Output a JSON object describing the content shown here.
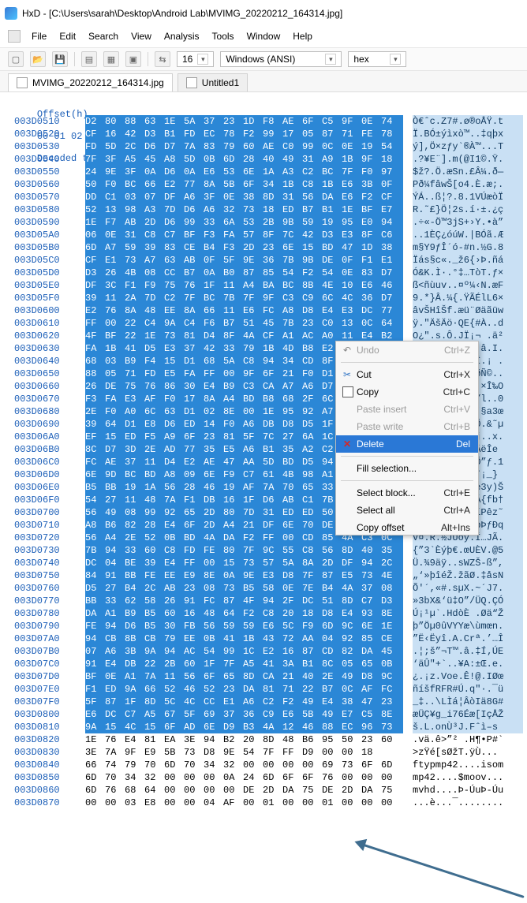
{
  "title_bar": {
    "title": "HxD - [C:\\Users\\sarah\\Desktop\\Android Lab\\MVIMG_20220212_164314.jpg]"
  },
  "menu": [
    "File",
    "Edit",
    "Search",
    "View",
    "Analysis",
    "Tools",
    "Window",
    "Help"
  ],
  "toolbar": {
    "bytes_per_row": "16",
    "encoding": "Windows (ANSI)",
    "number_format": "hex"
  },
  "tabs": [
    "MVIMG_20220212_164314.jpg",
    "Untitled1"
  ],
  "hex_header": {
    "offset": "Offset(h)",
    "columns": "00 01 02 03 04 05 06 07 08 09 0A 0B 0C 0D 0E 0F",
    "decoded": "Decoded text"
  },
  "rows": [
    {
      "offset": "003D0510",
      "bytes": "D2 80 88 63 1E 5A 37 23 1D F8 AE 6F C5 9F 0E 74",
      "text": "Ò€ˆc.Z7#.ø®oÅŸ.t"
    },
    {
      "offset": "003D0520",
      "bytes": "CF 16 42 D3 B1 FD EC 78 F2 99 17 05 87 71 FE 78",
      "text": "Ï.BÓ±ýìxò™..‡qþx"
    },
    {
      "offset": "003D0530",
      "bytes": "FD 5D 2C D6 D7 7A 83 79 60 AE C0 99 0C 0E 19 54",
      "text": "ý],Ö×zƒy`®À™...T"
    },
    {
      "offset": "003D0540",
      "bytes": "7F 3F A5 45 A8 5D 0B 6D 28 40 49 31 A9 1B 9F 18",
      "text": ".?¥E¨].m(@I1©.Ÿ."
    },
    {
      "offset": "003D0550",
      "bytes": "24 9E 3F 0A D6 0A E6 53 6E 1A A3 C2 BC 7F F0 97",
      "text": "$ž?.Ö.æSn.£Â¼.ð—"
    },
    {
      "offset": "003D0560",
      "bytes": "50 F0 BC 66 E2 77 8A 5B 6F 34 1B C8 1B E6 3B 0F",
      "text": "Pð¼fâwŠ[o4.È.æ;."
    },
    {
      "offset": "003D0570",
      "bytes": "DD C1 03 07 DF A6 3F 0E 38 8D 31 56 DA E6 F2 CF",
      "text": "ÝÁ..ß¦?.8.1VÚæòÏ"
    },
    {
      "offset": "003D0580",
      "bytes": "52 13 98 A3 7D D6 A6 32 73 18 ED B7 B1 1E BF E7",
      "text": "R.˜£}Ö¦2s.í·±.¿ç"
    },
    {
      "offset": "003D0590",
      "bytes": "1E F7 AB 2D D6 99 33 6A 53 2B 9B 59 19 95 E0 94",
      "text": ".÷«-Ö™3jS+›Y.•à”"
    },
    {
      "offset": "003D05A0",
      "bytes": "06 0E 31 C8 C7 BF F3 FA 57 8F 7C 42 D3 E3 8F C6",
      "text": "..1ÈÇ¿óúW.|BÓã.Æ"
    },
    {
      "offset": "003D05B0",
      "bytes": "6D A7 59 39 83 CE B4 F3 2D 23 6E 15 BD 47 1D 38",
      "text": "m§Y9ƒÎ´ó-#n.½G.8"
    },
    {
      "offset": "003D05C0",
      "bytes": "CF E1 73 A7 63 AB 0F 5F 9E 36 7B 9B DE 0F F1 E1",
      "text": "Ïás§c«._ž6{›Þ.ñá"
    },
    {
      "offset": "003D05D0",
      "bytes": "D3 26 4B 08 CC B7 0A B0 87 85 54 F2 54 0E 83 D7",
      "text": "Ó&K.Ì·.°‡…TòT.ƒ×"
    },
    {
      "offset": "003D05E0",
      "bytes": "DF 3C F1 F9 75 76 1F 11 A4 BA BC 8B 4E 10 E6 46",
      "text": "ß<ñùuv..¤º¼‹N.æF"
    },
    {
      "offset": "003D05F0",
      "bytes": "39 11 2A 7D C2 7F BC 7B 7F 9F C3 C9 6C 4C 36 D7",
      "text": "9.*}Â.¼{.ŸÃÉlL6×"
    },
    {
      "offset": "003D0600",
      "bytes": "E2 76 8A 48 EE 8A 66 11 E6 FC A8 D8 E4 E3 DC 77",
      "text": "âvŠHîŠf.æü¨Øäãüw"
    },
    {
      "offset": "003D0610",
      "bytes": "FF 00 22 C4 9A C4 F6 B7 51 45 7B 23 C0 13 0C 64",
      "text": "ÿ.\"ÄšÄö·QE{#À..d"
    },
    {
      "offset": "003D0620",
      "bytes": "4F BF 22 1E 73 81 D4 8F 4A CF A1 AC A0 11 E4 B2",
      "text": "O¿\".s.Ô.JÏ¡¬ .ä²"
    },
    {
      "offset": "003D0630",
      "bytes": "FA 1B 41 D5 E3 37 42 33 79 1B 4D B8 E2 1D 49 1B",
      "text": "ú.AÕã7B3y.M¸â.I."
    },
    {
      "offset": "003D0640",
      "bytes": "68 03 B9 F4 15 D1 68 5A C8 94 34 CD 8F A1 20 0D",
      "text": "h.¹ô.ÑhZÈ”4Í.¡ ."
    },
    {
      "offset": "003D0650",
      "bytes": "88 05 71 FD E5 FA FF 00 9F 6F 21 F0 D1 A9 0C 1F",
      "text": "ˆ.qýåúÿ.Ÿo!ðÑ©.."
    },
    {
      "offset": "003D0660",
      "bytes": "26 DE 75 76 86 30 E4 B9 C3 CA A7 A6 D7 CE 89 4F",
      "text": "&Þuv†0ä¹ÃÊ§¦×Î‰O"
    },
    {
      "offset": "003D0670",
      "bytes": "F3 FA E3 AF F0 17 8A A4 BD B8 68 2F 6C 1E 1F 30",
      "text": "óúã¯ð.Š¤½¸h/l..0"
    },
    {
      "offset": "003D0680",
      "bytes": "2E F0 A0 6C 63 D1 02 8E 00 1E 95 92 A7 61 33 9C",
      "text": ".ð lcÑ.Ž..•’§a3œ"
    },
    {
      "offset": "003D0690",
      "bytes": "39 64 D1 E8 D6 ED 14 F0 A6 DB D8 D5 1F 26 98 B5",
      "text": "9dÑèÖí.ð¦ÛØÕ.&˜µ"
    },
    {
      "offset": "003D06A0",
      "bytes": "EF 15 ED F5 A9 6F 23 81 5F 7C 27 6A 1C 9D 78 2E",
      "text": "ï.íõ©o#._|'j..x."
    },
    {
      "offset": "003D06B0",
      "bytes": "8C D7 3D 2E AD 77 35 E5 A6 B1 35 A2 C2 EB CE 65",
      "text": "Œ×=.­w5å¦±5¢ÂëÎe"
    },
    {
      "offset": "003D06C0",
      "bytes": "FC AE 37 11 D4 E2 AE 47 AA 5D BD D5 94 83 12 31",
      "text": "ü®7.Ôâ®Gª]½Õ”ƒ.1"
    },
    {
      "offset": "003D06D0",
      "bytes": "6E 9D BC BD A8 09 6E F9 C7 61 4B 98 A1 5F 7D 20",
      "text": "n.¼½¨.nùÇaK˜¡_} "
    },
    {
      "offset": "003D06E0",
      "bytes": "B5 BB 19 1A 56 28 46 19 AF 7A 70 65 33 79 29 8A",
      "text": "µ»..V(F.¯zpe3y)Š"
    },
    {
      "offset": "003D06F0",
      "bytes": "54 27 11 48 7A F1 DB 16 1F D6 AB C1 7B 66 62 86",
      "text": "T'.HzñÛ..Ö«Á{fb†"
    },
    {
      "offset": "003D0700",
      "bytes": "56 49 08 99 92 65 2D 80 7D 31 ED ED 50 EA 7A 98",
      "text": "VI.™’e-€}1ííPêz˜"
    },
    {
      "offset": "003D0710",
      "bytes": "A8 B6 82 28 E4 6F 2D A4 21 DF 6E 70 DE 83 D0 71",
      "text": "¨¶‚(äo-¤!ßnpÞƒÐq"
    },
    {
      "offset": "003D0720",
      "bytes": "56 A4 2E 52 0B BD 4A DA F2 FF 00 CD 85 4A C3 0C",
      "text": "V¤.R.½JÚòÿ.Í…JÃ."
    },
    {
      "offset": "003D0730",
      "bytes": "7B 94 33 60 C8 FD FE 80 7F 9C 55 C8 56 8D 40 35",
      "text": "{”3`Èýþ€.œUÈV.@5"
    },
    {
      "offset": "003D0740",
      "bytes": "DC 04 BE 39 E4 FF 00 15 73 57 5A 8A 2D DF 94 2C",
      "text": "Ü.¾9äÿ..sWZŠ-ß”,"
    },
    {
      "offset": "003D0750",
      "bytes": "84 91 BB FE EE E9 8E 0A 9E E3 D8 7F 87 E5 73 4E",
      "text": "„‘»þîéŽ.žãØ.‡åsN"
    },
    {
      "offset": "003D0760",
      "bytes": "D5 27 B4 2C AB 23 08 73 B5 58 0E 7E B4 4A 37 08",
      "text": "Õ'´,«#.sµX.~´J7."
    },
    {
      "offset": "003D0770",
      "bytes": "BB 33 62 58 26 91 FC 87 4F 94 2F DC 51 8D C7 D3",
      "text": "»3bX&‘ü‡O”/ÜQ.ÇÓ"
    },
    {
      "offset": "003D0780",
      "bytes": "DA A1 B9 B5 60 16 48 64 F2 C8 20 18 D8 E4 93 8E",
      "text": "Ú¡¹µ`.HdòÈ .Øä“Ž"
    },
    {
      "offset": "003D0790",
      "bytes": "FE 94 D6 B5 30 FB 56 59 59 E6 5C F9 6D 9C 6E 1E",
      "text": "þ”Öµ0ûVYYæ\\ùmœn."
    },
    {
      "offset": "003D07A0",
      "bytes": "94 CB 8B CB 79 EE 0B 41 1B 43 72 AA 04 92 85 CE",
      "text": "”Ë‹Ëyî.A.Crª.’…Î"
    },
    {
      "offset": "003D07B0",
      "bytes": "07 A6 3B 9A 94 AC 54 99 1C E2 16 87 CD 82 DA 45",
      "text": ".¦;š”¬T™.â.‡Í‚ÚE"
    },
    {
      "offset": "003D07C0",
      "bytes": "91 E4 DB 22 2B 60 1F 7F A5 41 3A B1 8C 05 65 0B",
      "text": "‘äÛ\"+`..¥A:±Œ.e."
    },
    {
      "offset": "003D07D0",
      "bytes": "BF 0E A1 7A 11 56 6F 65 8D CA 21 40 2E 49 D8 9C",
      "text": "¿.¡z.Voe.Ê!@.IØœ"
    },
    {
      "offset": "003D07E0",
      "bytes": "F1 ED 9A 66 52 46 52 23 DA 81 71 22 B7 0C AF FC",
      "text": "ñíšfRFR#Ú.q\"·.¯ü"
    },
    {
      "offset": "003D07F0",
      "bytes": "5F 87 1F 8D 5C 4C CC E1 A6 C2 F2 49 E4 38 47 23",
      "text": "_‡..\\LÌá¦ÂòIä8G#"
    },
    {
      "offset": "003D0800",
      "bytes": "E6 DC C7 A5 67 5F 69 37 36 C9 E6 5B 49 E7 C5 8E",
      "text": "æÜÇ¥g_i76Éæ[IçÅŽ"
    },
    {
      "offset": "003D0810",
      "bytes": "9A 15 4C 15 6F AD 6E D9 B3 4A 12 46 88 EC 96 73",
      "text": "š.L.o­nÙ³J.Fˆì–s"
    },
    {
      "offset": "003D0820",
      "bytes": "1E 76 E4 81 EA 3E 94 B2 20 8D 48 B6 95 50 23 60",
      "text": ".vä.ê>”² .H¶•P#`"
    },
    {
      "offset": "003D0830",
      "bytes": "3E 7A 9F E9 5B 73 D8 9E 54 7F FF D9 00 00 18",
      "text": ">zŸé[sØžT.ÿÙ..."
    },
    {
      "offset": "003D0840",
      "bytes": "66 74 79 70 6D 70 34 32 00 00 00 00 69 73 6F 6D",
      "text": "ftypmp42....isom"
    },
    {
      "offset": "003D0850",
      "bytes": "6D 70 34 32 00 00 00 0A 24 6D 6F 6F 76 00 00 00",
      "text": "mp42....$moov..."
    },
    {
      "offset": "003D0860",
      "bytes": "6D 76 68 64 00 00 00 00 DE 2D DA 75 DE 2D DA 75",
      "text": "mvhd....Þ-ÚuÞ-Úu"
    },
    {
      "offset": "003D0870",
      "bytes": "00 00 03 E8 00 00 04 AF 00 01 00 00 01 00 00 00",
      "text": "...è...¯........"
    }
  ],
  "context_menu": {
    "undo": {
      "label": "Undo",
      "shortcut": "Ctrl+Z"
    },
    "cut": {
      "label": "Cut",
      "shortcut": "Ctrl+X"
    },
    "copy": {
      "label": "Copy",
      "shortcut": "Ctrl+C"
    },
    "paste_insert": {
      "label": "Paste insert",
      "shortcut": "Ctrl+V"
    },
    "paste_write": {
      "label": "Paste write",
      "shortcut": "Ctrl+B"
    },
    "delete": {
      "label": "Delete",
      "shortcut": "Del"
    },
    "fill_selection": {
      "label": "Fill selection..."
    },
    "select_block": {
      "label": "Select block...",
      "shortcut": "Ctrl+E"
    },
    "select_all": {
      "label": "Select all",
      "shortcut": "Ctrl+A"
    },
    "copy_offset": {
      "label": "Copy offset",
      "shortcut": "Alt+Ins"
    }
  },
  "colors": {
    "selection": "#2b87d6",
    "text_selection": "#c9e0f4",
    "offset": "#1c5fb8",
    "context_highlight": "#2a78d6"
  }
}
